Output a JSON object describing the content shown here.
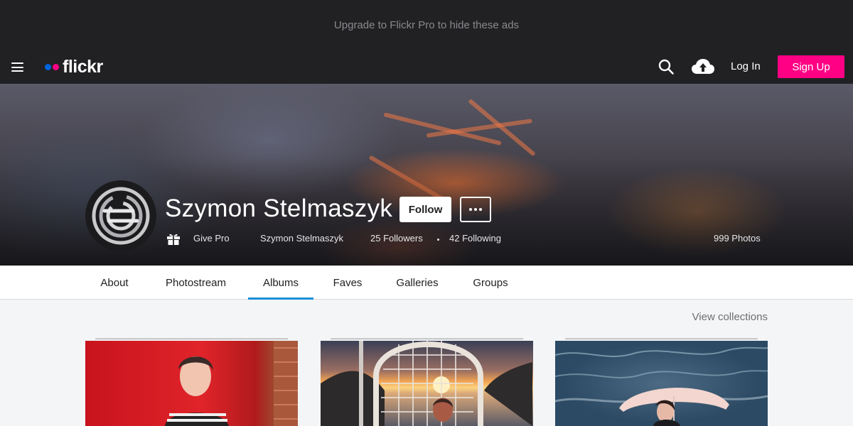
{
  "ad_bar": {
    "text": "Upgrade to Flickr Pro to hide these ads"
  },
  "nav": {
    "logo_text": "flickr",
    "login_label": "Log In",
    "signup_label": "Sign Up",
    "icons": [
      "menu-icon",
      "search-icon",
      "cloud-upload-icon"
    ],
    "colors": {
      "brand_blue": "#0063dc",
      "brand_pink": "#ff0084",
      "bar": "#212124"
    }
  },
  "profile": {
    "name": "Szymon Stelmaszyk",
    "follow_label": "Follow",
    "give_pro_label": "Give Pro",
    "username": "Szymon Stelmaszyk",
    "followers": "25 Followers",
    "following": "42 Following",
    "photos": "999 Photos"
  },
  "tabs": [
    {
      "label": "About",
      "active": false
    },
    {
      "label": "Photostream",
      "active": false
    },
    {
      "label": "Albums",
      "active": true
    },
    {
      "label": "Faves",
      "active": false
    },
    {
      "label": "Galleries",
      "active": false
    },
    {
      "label": "Groups",
      "active": false
    }
  ],
  "albums": {
    "view_collections_label": "View collections",
    "accent_color": "#128fdc"
  }
}
